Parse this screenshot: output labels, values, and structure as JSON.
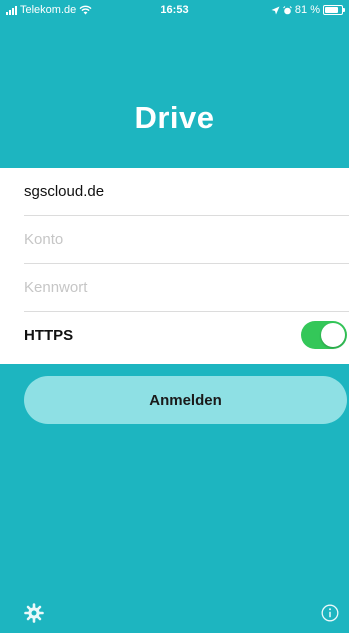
{
  "status_bar": {
    "carrier": "Telekom.de",
    "time": "16:53",
    "battery_text": "81 %",
    "battery_level": 0.81,
    "icons": [
      "signal-bars-icon",
      "wifi-icon",
      "location-arrow-icon",
      "alarm-icon",
      "battery-icon"
    ]
  },
  "header": {
    "title": "Drive"
  },
  "form": {
    "server": {
      "value": "sgscloud.de",
      "placeholder": ""
    },
    "account": {
      "value": "",
      "placeholder": "Konto"
    },
    "password": {
      "value": "",
      "placeholder": "Kennwort"
    },
    "https": {
      "label": "HTTPS",
      "enabled": true
    }
  },
  "actions": {
    "login_label": "Anmelden"
  },
  "footer": {
    "left_icon": "gear-icon",
    "right_icon": "info-icon"
  },
  "colors": {
    "brand": "#1db5c0",
    "button": "#8ee0e4",
    "toggle_on": "#34c759",
    "placeholder": "#c6c6c6"
  }
}
